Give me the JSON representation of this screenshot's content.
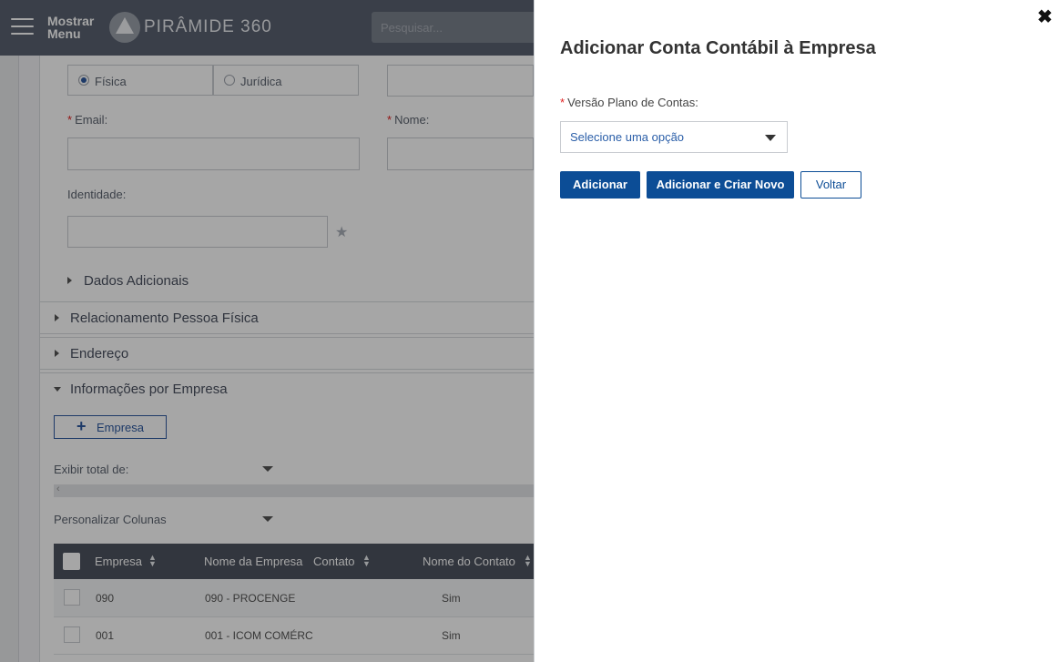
{
  "header": {
    "menu_label": "Mostrar Menu",
    "brand": "PIRÂMIDE 360",
    "search_placeholder": "Pesquisar..."
  },
  "form": {
    "person_type": {
      "options": [
        "Física",
        "Jurídica"
      ],
      "selected": "Física"
    },
    "email_label": "Email:",
    "name_label": "Nome:",
    "identity_label": "Identidade:",
    "additional_data": "Dados Adicionais"
  },
  "sections": {
    "relationship": "Relacionamento Pessoa Física",
    "address": "Endereço",
    "company_info": "Informações por Empresa"
  },
  "company_section": {
    "add_button": "Empresa",
    "show_total_label": "Exibir total de:",
    "customize_columns_label": "Personalizar Colunas"
  },
  "table": {
    "columns": [
      "Empresa",
      "Nome da Empresa",
      "Contato",
      "Nome do Contato"
    ],
    "rows": [
      {
        "empresa": "090",
        "nome_empresa": "090 - PROCENGE",
        "contato": "Sim"
      },
      {
        "empresa": "001",
        "nome_empresa": "001 - ICOM COMÉRC",
        "contato": "Sim"
      }
    ]
  },
  "modal": {
    "title": "Adicionar Conta Contábil à Empresa",
    "field_label": "Versão Plano de Contas:",
    "select_placeholder": "Selecione uma opção",
    "buttons": {
      "add": "Adicionar",
      "add_and_new": "Adicionar e Criar Novo",
      "back": "Voltar"
    }
  },
  "colors": {
    "primary": "#0c4d96",
    "header_bg": "#596170",
    "required": "#e02020"
  }
}
